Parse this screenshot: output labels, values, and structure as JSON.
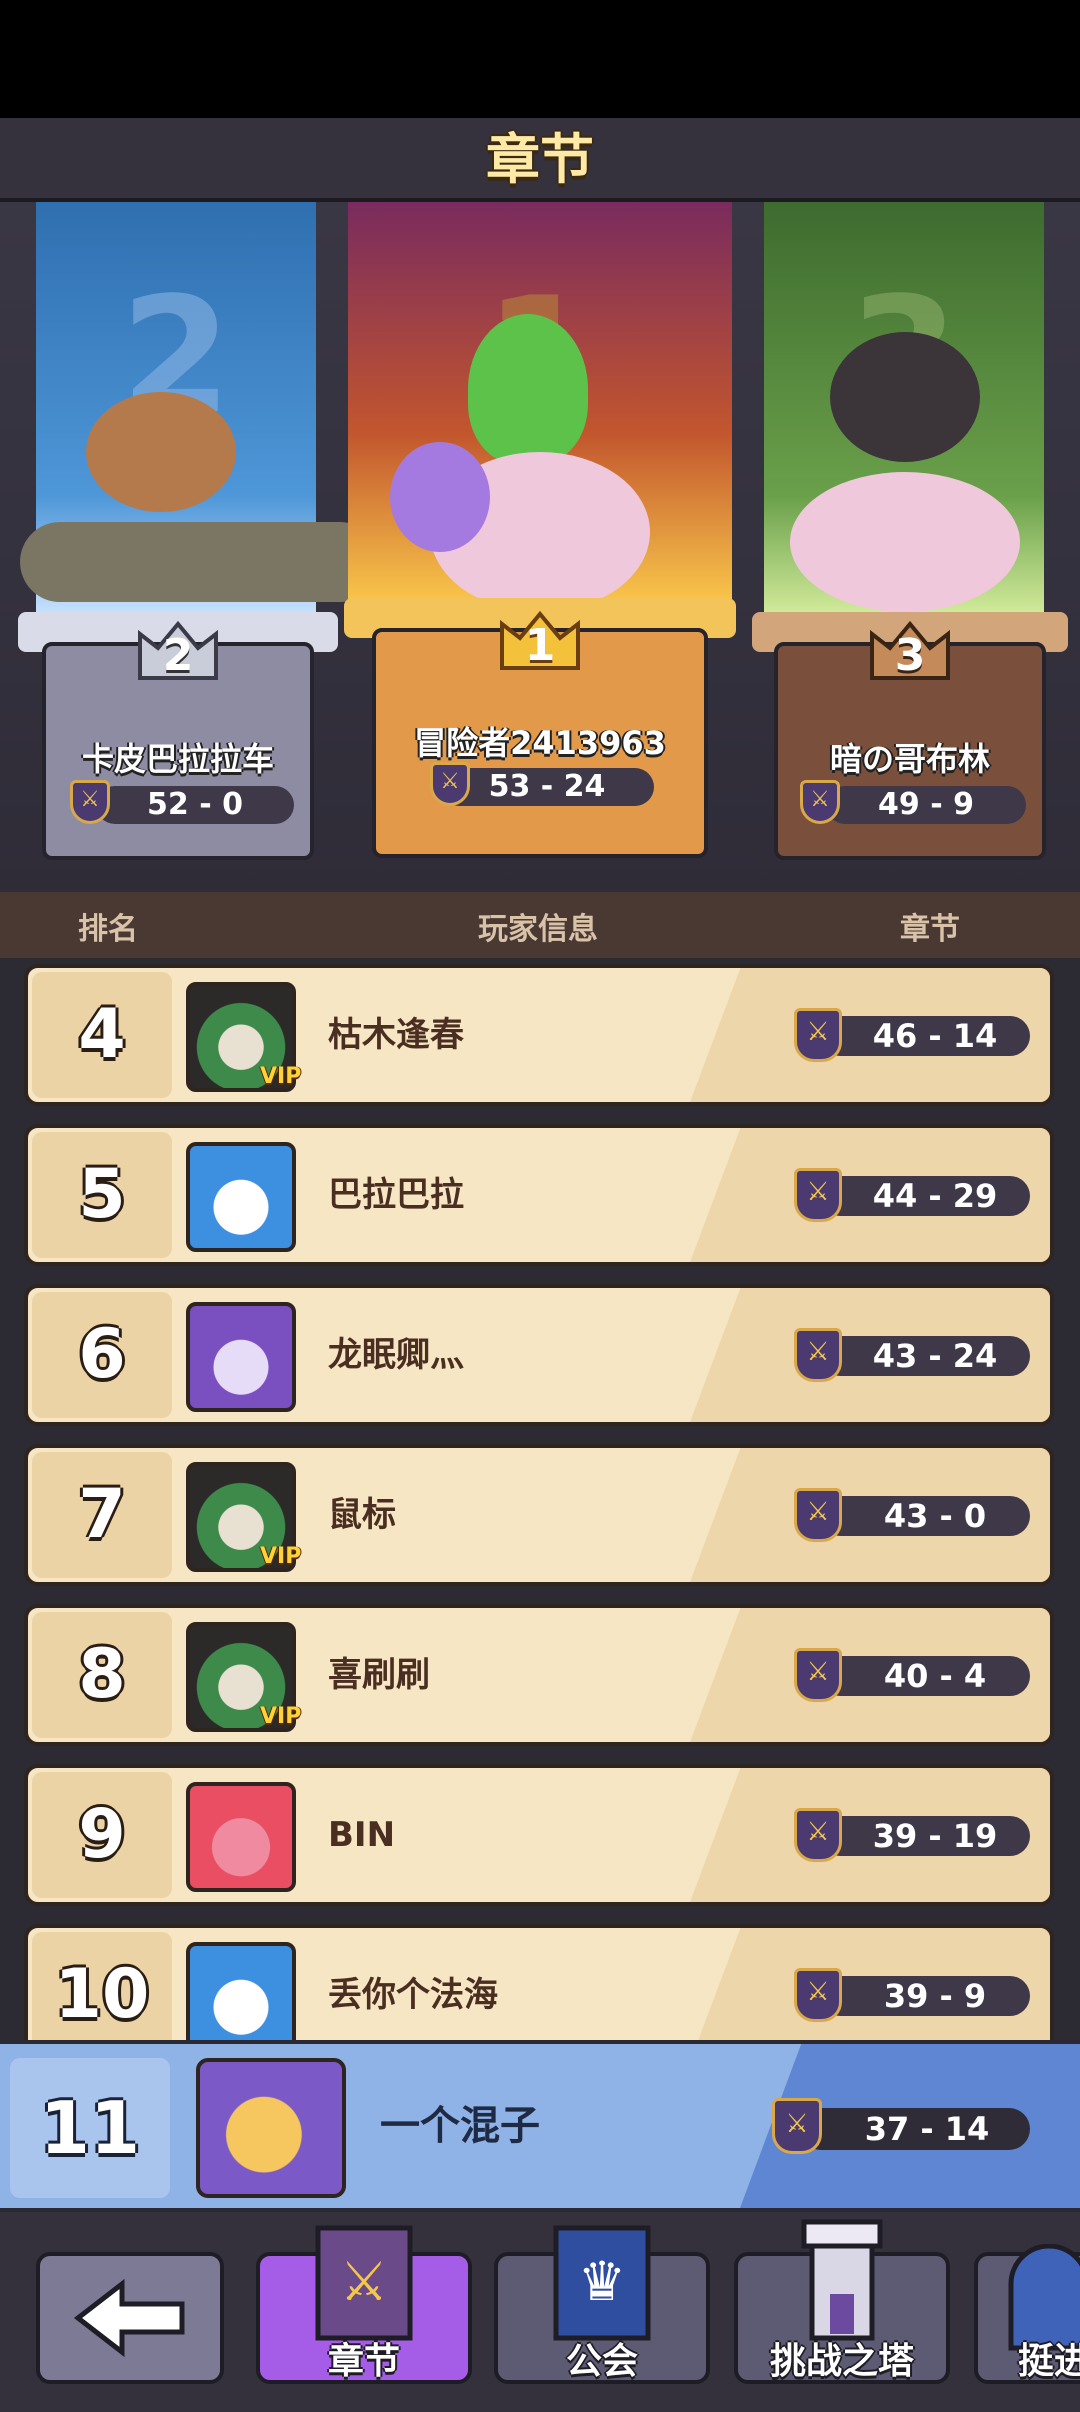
{
  "header": {
    "title": "章节"
  },
  "podium": [
    {
      "place": "2",
      "banner_num": "2",
      "name": "卡皮巴拉拉车",
      "score": "52 - 0"
    },
    {
      "place": "1",
      "banner_num": "1",
      "name": "冒险者2413963",
      "score": "53 - 24"
    },
    {
      "place": "3",
      "banner_num": "3",
      "name": "暗の哥布林",
      "score": "49 - 9"
    }
  ],
  "columns": {
    "rank": "排名",
    "player": "玩家信息",
    "chapter": "章节"
  },
  "rows": [
    {
      "rank": "4",
      "name": "枯木逢春",
      "score": "46 - 14",
      "vip": "VIP"
    },
    {
      "rank": "5",
      "name": "巴拉巴拉",
      "score": "44 - 29"
    },
    {
      "rank": "6",
      "name": "龙眠卿灬",
      "score": "43 - 24"
    },
    {
      "rank": "7",
      "name": "鼠标",
      "score": "43 - 0",
      "vip": "VIP"
    },
    {
      "rank": "8",
      "name": "喜刷刷",
      "score": "40 - 4",
      "vip": "VIP"
    },
    {
      "rank": "9",
      "name": "BIN",
      "score": "39 - 19"
    },
    {
      "rank": "10",
      "name": "丢你个法海",
      "score": "39 - 9"
    }
  ],
  "me": {
    "rank": "11",
    "name": "一个混子",
    "score": "37 - 14"
  },
  "nav": {
    "back_icon": "arrow-left-icon",
    "chapter": "章节",
    "guild": "公会",
    "tower": "挑战之塔",
    "advance": "挺进"
  }
}
